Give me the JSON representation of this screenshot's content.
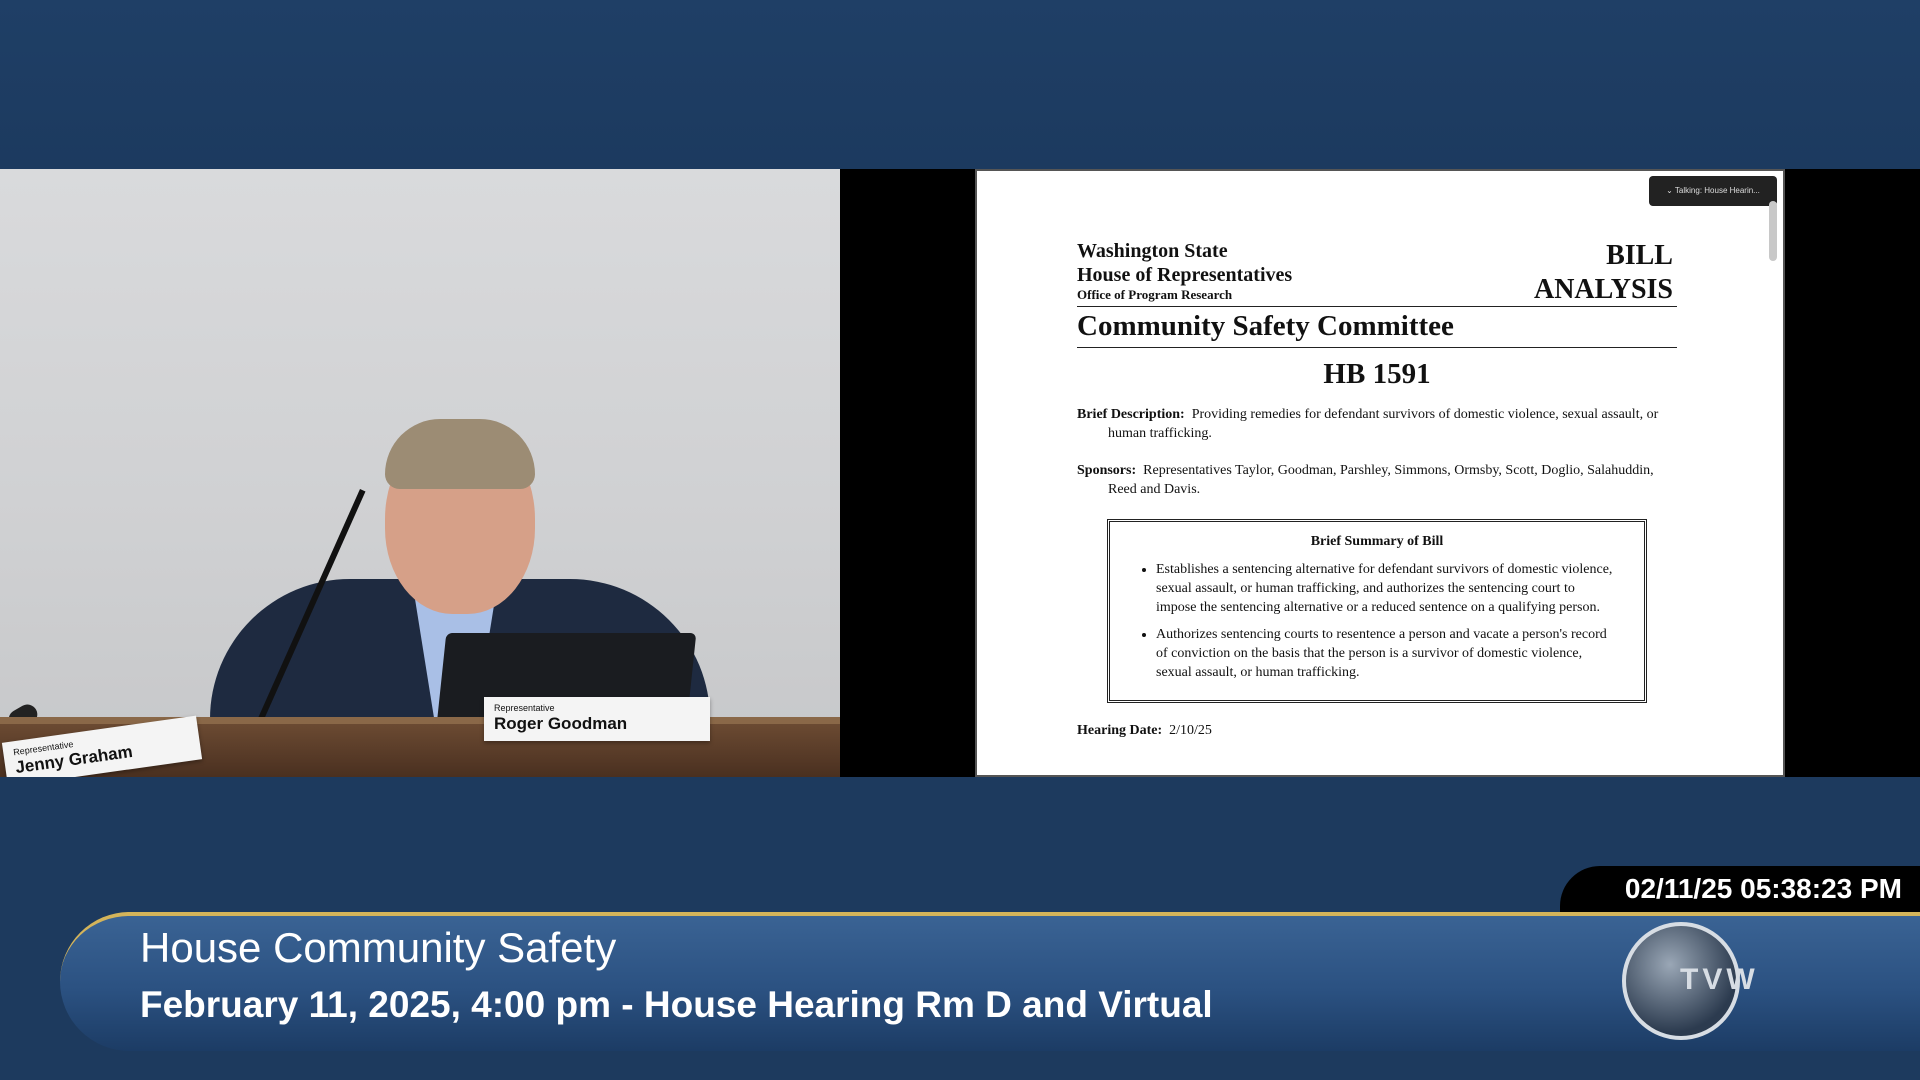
{
  "camera": {
    "nameplates": [
      {
        "title": "Representative",
        "name": "Jenny Graham"
      },
      {
        "title": "Representative",
        "name": "Roger Goodman"
      }
    ]
  },
  "document": {
    "state": "Washington State",
    "house": "House of Representatives",
    "office": "Office of Program Research",
    "bill_line1": "BILL",
    "bill_line2": "ANALYSIS",
    "committee": "Community Safety Committee",
    "bill_number": "HB 1591",
    "brief_description_label": "Brief Description:",
    "brief_description": "Providing remedies for defendant survivors of domestic violence, sexual assault, or human trafficking.",
    "sponsors_label": "Sponsors:",
    "sponsors": "Representatives Taylor, Goodman, Parshley, Simmons, Ormsby, Scott, Doglio, Salahuddin, Reed and Davis.",
    "summary_title": "Brief Summary of Bill",
    "summary_items": [
      "Establishes a sentencing alternative for defendant survivors of domestic violence, sexual assault, or human trafficking, and authorizes the sentencing court to impose the sentencing alternative or a reduced sentence on a qualifying person.",
      "Authorizes sentencing courts to resentence a person and vacate a person's record of conviction on the basis that the person is a survivor of domestic violence, sexual assault, or human trafficking."
    ],
    "hearing_date_label": "Hearing Date:",
    "hearing_date": "2/10/25",
    "tooltip": "Talking: House Hearin..."
  },
  "broadcast": {
    "timestamp": "02/11/25 05:38:23 PM",
    "title": "House Community Safety",
    "subtitle": "February 11, 2025, 4:00 pm - House Hearing Rm D and Virtual",
    "logo_text": "TVW"
  },
  "colors": {
    "background": "#1d3a5e",
    "lower_third": "#2b5181",
    "accent_line": "#d4b45a"
  }
}
